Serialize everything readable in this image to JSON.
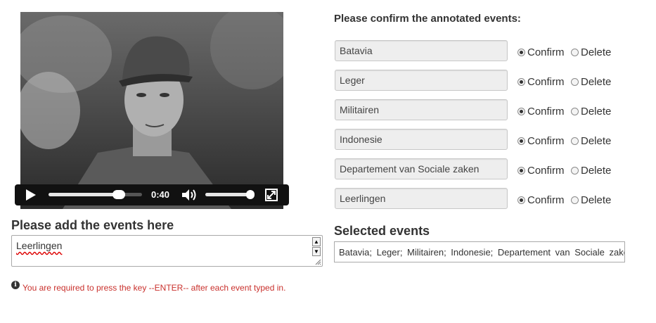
{
  "video": {
    "time": "0:40",
    "progress_fraction": 0.75,
    "volume_fraction": 0.98
  },
  "add_events": {
    "title": "Please add the events here",
    "input_value": "Leerlingen",
    "warning": "You are required to press the key --ENTER-- after each event typed in."
  },
  "confirm": {
    "title": "Please confirm the annotated events:",
    "confirm_label": "Confirm",
    "delete_label": "Delete",
    "events": [
      {
        "label": "Batavia",
        "selected": "confirm"
      },
      {
        "label": "Leger",
        "selected": "confirm"
      },
      {
        "label": "Militairen",
        "selected": "confirm"
      },
      {
        "label": "Indonesie",
        "selected": "confirm"
      },
      {
        "label": "Departement van Sociale zaken",
        "selected": "confirm"
      },
      {
        "label": "Leerlingen",
        "selected": "confirm"
      }
    ]
  },
  "selected": {
    "title": "Selected events",
    "value": "Batavia;  Leger;  Militairen;  Indonesie;  Departement van Sociale zaken"
  },
  "icons": {
    "play": "play-icon",
    "volume": "volume-icon",
    "fullscreen": "fullscreen-icon",
    "info": "info-icon"
  }
}
